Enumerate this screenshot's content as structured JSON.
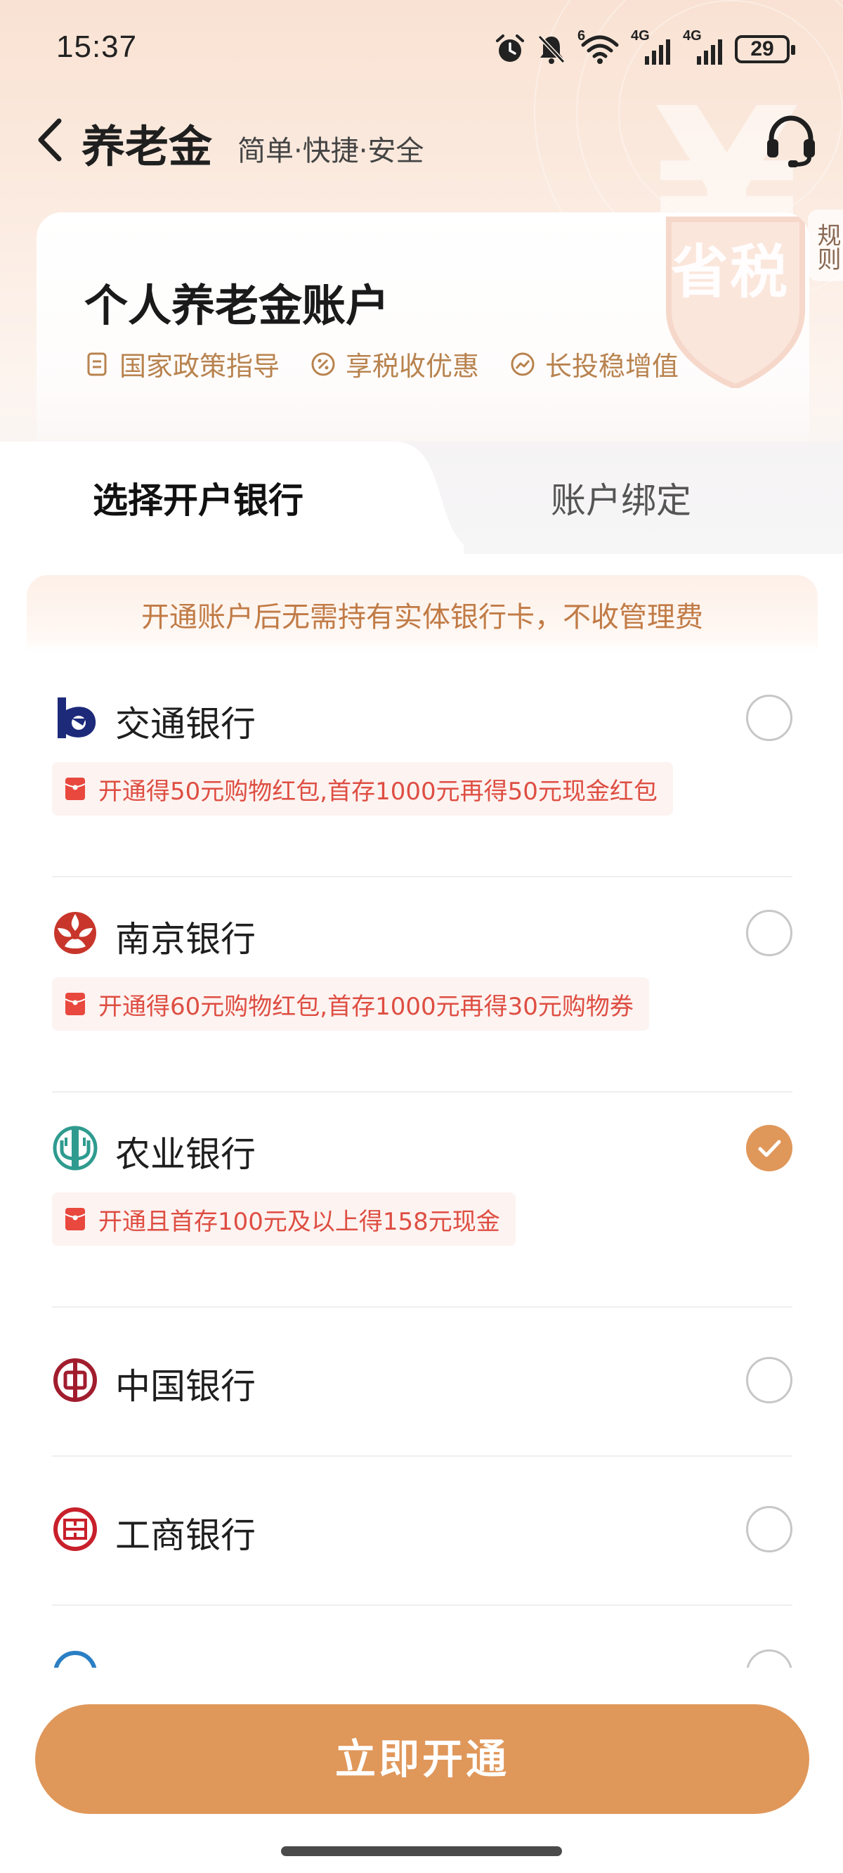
{
  "status_bar": {
    "time": "15:37",
    "network_label_1": "4G",
    "network_label_2": "4G",
    "wifi_label": "6",
    "battery": "29",
    "icons": [
      "alarm-icon",
      "mute-icon",
      "wifi-icon",
      "signal-icon",
      "signal-icon",
      "battery-icon"
    ]
  },
  "header": {
    "title": "养老金",
    "subtitle": "简单·快捷·安全",
    "service_icon": "headset-icon",
    "back_icon": "chevron-left-icon"
  },
  "rules_tab": {
    "label": "规则"
  },
  "account_card": {
    "title": "个人养老金账户",
    "badge_text": "省税",
    "features": [
      {
        "label": "国家政策指导",
        "icon": "document-icon"
      },
      {
        "label": "享税收优惠",
        "icon": "percent-icon"
      },
      {
        "label": "长投稳增值",
        "icon": "growth-icon"
      }
    ]
  },
  "tabs": [
    {
      "label": "选择开户银行",
      "active": true
    },
    {
      "label": "账户绑定",
      "active": false
    }
  ],
  "notice": {
    "text": "开通账户后无需持有实体银行卡，不收管理费"
  },
  "banks": [
    {
      "name": "交通银行",
      "promo": "开通得50元购物红包,首存1000元再得50元现金红包",
      "selected": false,
      "logo_color": "#1d2a7a"
    },
    {
      "name": "南京银行",
      "promo": "开通得60元购物红包,首存1000元再得30元购物券",
      "selected": false,
      "logo_color": "#c8362b"
    },
    {
      "name": "农业银行",
      "promo": "开通且首存100元及以上得158元现金",
      "selected": true,
      "logo_color": "#2f9b8f"
    },
    {
      "name": "中国银行",
      "promo": "",
      "selected": false,
      "logo_color": "#a11d2e"
    },
    {
      "name": "工商银行",
      "promo": "",
      "selected": false,
      "logo_color": "#c8202b"
    }
  ],
  "colors": {
    "accent": "#e0975a",
    "promo_text": "#de4e42",
    "feature_text": "#b8834f"
  },
  "bottom": {
    "button_label": "立即开通"
  }
}
